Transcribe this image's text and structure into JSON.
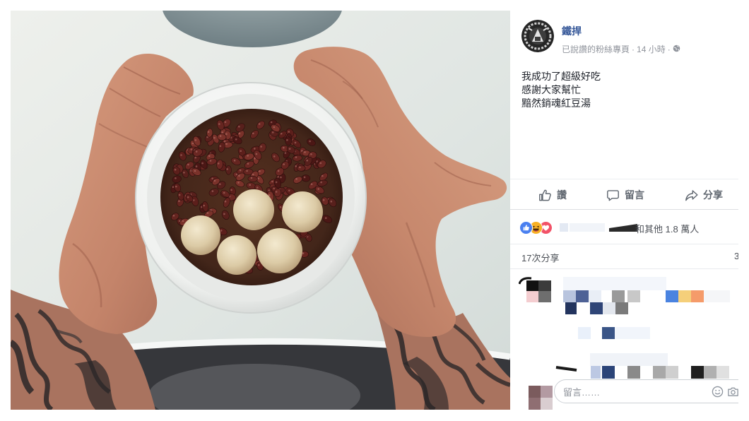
{
  "page": {
    "name": "鐵捍",
    "relation": "已說讚的粉絲專頁",
    "separator": "·",
    "time": "14 小時",
    "privacy_icon": "globe-icon"
  },
  "post": {
    "lines": [
      "我成功了超級好吃",
      "感謝大家幫忙",
      "黯然銷魂紅豆湯"
    ]
  },
  "actions": {
    "like": "讚",
    "comment": "留言",
    "share": "分享"
  },
  "reactions": {
    "types": [
      "like-icon",
      "haha-icon",
      "love-icon"
    ],
    "summary": "和其他 1.8 萬人"
  },
  "shares": {
    "label": "17次分享"
  },
  "comments": {
    "count_partial": "3"
  },
  "composer": {
    "placeholder": "留言……",
    "icons": [
      "smile-icon",
      "camera-icon"
    ]
  },
  "photo": {
    "subject": "bowl-of-red-bean-soup-with-tangyuan",
    "tangyuan_count": 5
  },
  "colors": {
    "link": "#365899",
    "text": "#1d2129",
    "muted": "#90949c",
    "action": "#606770",
    "like": "#4a80f0",
    "haha": "#f7b125",
    "love": "#f25268"
  }
}
